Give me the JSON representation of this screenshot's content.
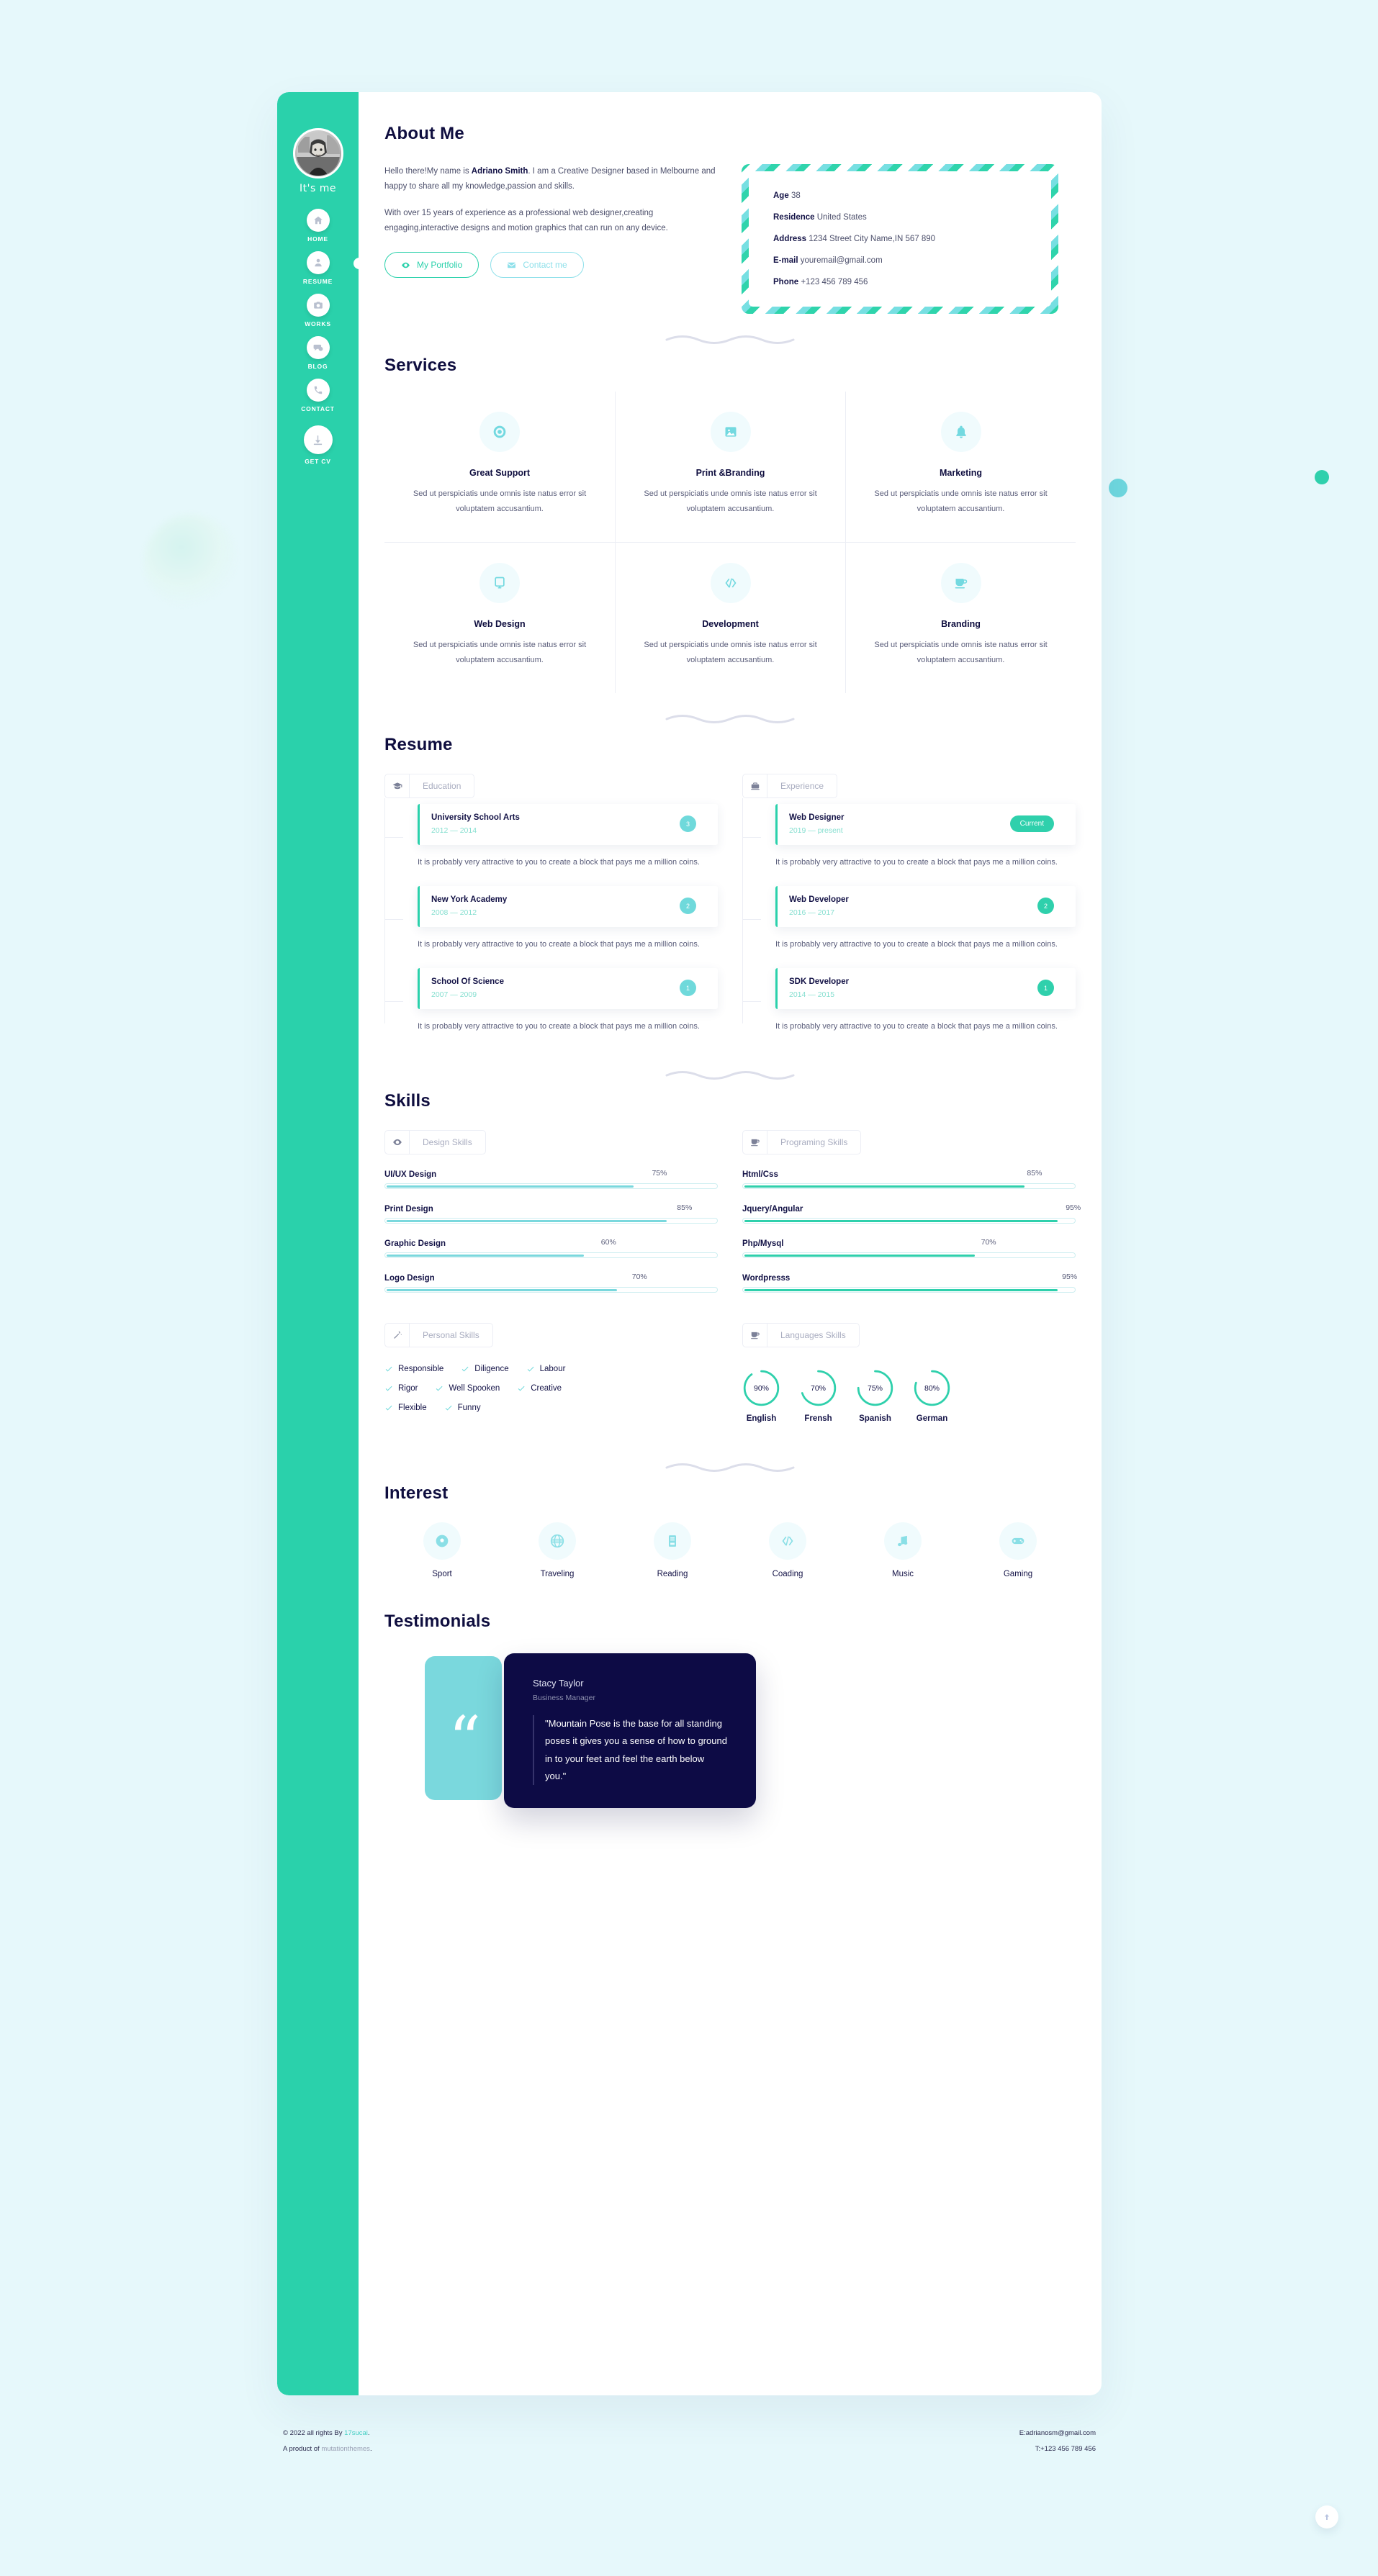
{
  "sidebar": {
    "avatar_caption": "It's me",
    "items": [
      {
        "label": "HOME",
        "icon": "home-icon"
      },
      {
        "label": "RESUME",
        "icon": "user-icon",
        "active": true
      },
      {
        "label": "WORKS",
        "icon": "camera-icon"
      },
      {
        "label": "BLOG",
        "icon": "chat-icon"
      },
      {
        "label": "CONTACT",
        "icon": "phone-icon"
      }
    ],
    "cta": {
      "label": "GET CV",
      "icon": "download-icon"
    }
  },
  "about": {
    "title": "About Me",
    "paragraph1_pre": "Hello there!My name is ",
    "paragraph1_name": "Adriano Smith",
    "paragraph1_post": ". I am a Creative Designer based in Melbourne and happy to share all my knowledge,passion and skills.",
    "paragraph2": "With over 15 years of experience as a professional web designer,creating engaging,interactive designs and motion graphics that can run on any device.",
    "buttons": [
      {
        "label": "My Portfolio",
        "icon": "eye-icon"
      },
      {
        "label": "Contact me",
        "icon": "envelope-icon"
      }
    ],
    "info": [
      {
        "label": "Age",
        "value": "38"
      },
      {
        "label": "Residence",
        "value": "United States"
      },
      {
        "label": "Address",
        "value": "1234 Street City Name,IN 567 890"
      },
      {
        "label": "E-mail",
        "value": "youremail@gmail.com"
      },
      {
        "label": "Phone",
        "value": "+123 456 789 456"
      }
    ]
  },
  "services": {
    "title": "Services",
    "items": [
      {
        "name": "Great Support",
        "desc": "Sed ut perspiciatis unde omnis iste natus error sit voluptatem accusantium.",
        "icon": "lifebuoy-icon"
      },
      {
        "name": "Print &Branding",
        "desc": "Sed ut perspiciatis unde omnis iste natus error sit voluptatem accusantium.",
        "icon": "image-icon"
      },
      {
        "name": "Marketing",
        "desc": "Sed ut perspiciatis unde omnis iste natus error sit voluptatem accusantium.",
        "icon": "bell-icon"
      },
      {
        "name": "Web Design",
        "desc": "Sed ut perspiciatis unde omnis iste natus error sit voluptatem accusantium.",
        "icon": "monitor-icon"
      },
      {
        "name": "Development",
        "desc": "Sed ut perspiciatis unde omnis iste natus error sit voluptatem accusantium.",
        "icon": "code-icon"
      },
      {
        "name": "Branding",
        "desc": "Sed ut perspiciatis unde omnis iste natus error sit voluptatem accusantium.",
        "icon": "coffee-icon"
      }
    ]
  },
  "resume": {
    "title": "Resume",
    "education_tab": {
      "label": "Education",
      "icon": "graduation-cap-icon"
    },
    "experience_tab": {
      "label": "Experience",
      "icon": "briefcase-icon"
    },
    "education": [
      {
        "title": "University School Arts",
        "date": "2012 — 2014",
        "badge": "3",
        "desc": "It is probably very attractive to you to create a block that pays me a million coins."
      },
      {
        "title": "New York Academy",
        "date": "2008 — 2012",
        "badge": "2",
        "desc": "It is probably very attractive to you to create a block that pays me a million coins."
      },
      {
        "title": "School Of Science",
        "date": "2007 — 2009",
        "badge": "1",
        "desc": "It is probably very attractive to you to create a block that pays me a million coins."
      }
    ],
    "experience": [
      {
        "title": "Web Designer",
        "date": "2019 — present",
        "badge": "Current",
        "current": true,
        "desc": "It is probably very attractive to you to create a block that pays me a million coins."
      },
      {
        "title": "Web Developer",
        "date": "2016 — 2017",
        "badge": "2",
        "desc": "It is probably very attractive to you to create a block that pays me a million coins."
      },
      {
        "title": "SDK Developer",
        "date": "2014 — 2015",
        "badge": "1",
        "desc": "It is probably very attractive to you to create a block that pays me a million coins."
      }
    ]
  },
  "skills": {
    "title": "Skills",
    "design_tab": {
      "label": "Design Skills",
      "icon": "eye-icon"
    },
    "programming_tab": {
      "label": "Programing Skills",
      "icon": "coffee-icon"
    },
    "personal_tab": {
      "label": "Personal Skills",
      "icon": "magic-wand-icon"
    },
    "languages_tab": {
      "label": "Languages Skills",
      "icon": "coffee-icon"
    },
    "design": [
      {
        "name": "UI/UX Design",
        "pct": "75%",
        "value": 75
      },
      {
        "name": "Print Design",
        "pct": "85%",
        "value": 85
      },
      {
        "name": "Graphic Design",
        "pct": "60%",
        "value": 60
      },
      {
        "name": "Logo Design",
        "pct": "70%",
        "value": 70
      }
    ],
    "programming": [
      {
        "name": "Html/Css",
        "pct": "85%",
        "value": 85
      },
      {
        "name": "Jquery/Angular",
        "pct": "95%",
        "value": 95
      },
      {
        "name": "Php/Mysql",
        "pct": "70%",
        "value": 70
      },
      {
        "name": "Wordpresss",
        "pct": "95%",
        "value": 95
      }
    ],
    "personal": [
      [
        "Responsible",
        "Diligence",
        "Labour"
      ],
      [
        "Rigor",
        "Well Spooken",
        "Creative"
      ],
      [
        "Flexible",
        "Funny"
      ]
    ],
    "languages": [
      {
        "name": "English",
        "pct": "90%",
        "value": 90
      },
      {
        "name": "Frensh",
        "pct": "70%",
        "value": 70
      },
      {
        "name": "Spanish",
        "pct": "75%",
        "value": 75
      },
      {
        "name": "German",
        "pct": "80%",
        "value": 80
      }
    ]
  },
  "interest": {
    "title": "Interest",
    "items": [
      {
        "name": "Sport",
        "icon": "football-icon"
      },
      {
        "name": "Traveling",
        "icon": "globe-icon"
      },
      {
        "name": "Reading",
        "icon": "book-icon"
      },
      {
        "name": "Coading",
        "icon": "code-icon"
      },
      {
        "name": "Music",
        "icon": "music-note-icon"
      },
      {
        "name": "Gaming",
        "icon": "gamepad-icon"
      }
    ]
  },
  "testimonials": {
    "title": "Testimonials",
    "quote_mark": "“",
    "author": "Stacy Taylor",
    "role": "Business Manager",
    "quote": "\"Mountain Pose is the base for all standing poses it gives you a sense of how to ground in to your feet and feel the earth below you.\""
  },
  "footer": {
    "copyright_pre": "© 2022 all rights By ",
    "copyright_link": "17sucai",
    "copyright_post": ".",
    "product_pre": "A product of ",
    "product_link": "mutationthemes",
    "product_post": ".",
    "email": "E:adrianosm@gmail.com",
    "phone": "T:+123 456 789 456"
  },
  "colors": {
    "brand_green": "#2ad1ab",
    "brand_cyan": "#7ad8dd",
    "dark_navy": "#0d0b45",
    "page_bg": "#e6f8fb"
  }
}
